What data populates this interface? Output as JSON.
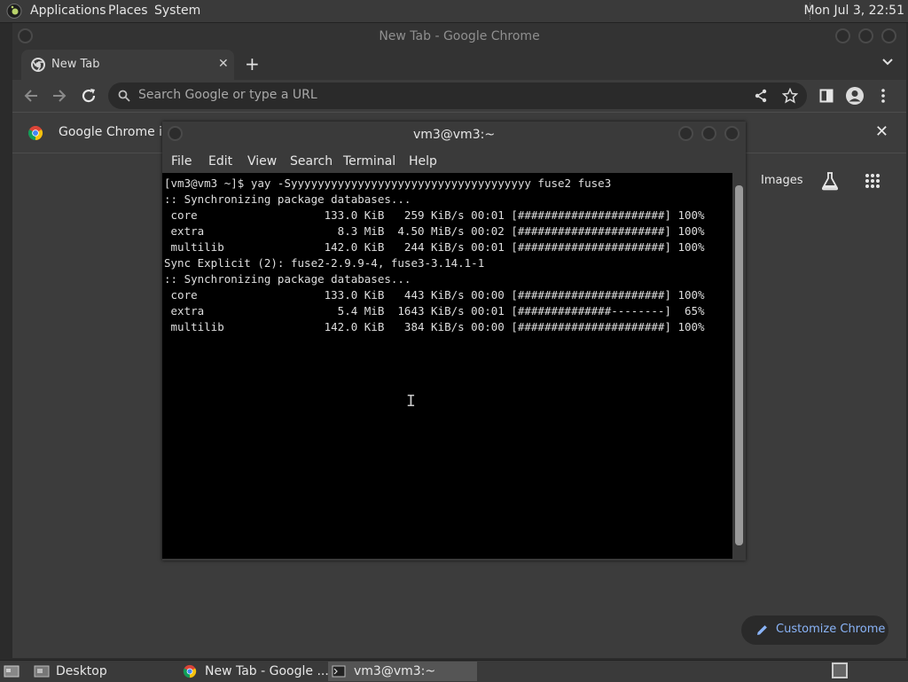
{
  "top_panel": {
    "menus": [
      "Applications",
      "Places",
      "System"
    ],
    "clock": "Mon Jul  3, 22:51"
  },
  "chrome": {
    "window_title": "New Tab - Google Chrome",
    "tab_title": "New Tab",
    "omnibox_placeholder": "Search Google or type a URL",
    "infobar_text": "Google Chrome isn",
    "images_link": "Images",
    "customize_label": "Customize Chrome"
  },
  "terminal": {
    "title": "vm3@vm3:~",
    "menus": [
      "File",
      "Edit",
      "View",
      "Search",
      "Terminal",
      "Help"
    ],
    "lines": [
      "[vm3@vm3 ~]$ yay -Syyyyyyyyyyyyyyyyyyyyyyyyyyyyyyyyyyyy fuse2 fuse3",
      ":: Synchronizing package databases...",
      " core                   133.0 KiB   259 KiB/s 00:01 [######################] 100%",
      " extra                    8.3 MiB  4.50 MiB/s 00:02 [######################] 100%",
      " multilib               142.0 KiB   244 KiB/s 00:01 [######################] 100%",
      "Sync Explicit (2): fuse2-2.9.9-4, fuse3-3.14.1-1",
      ":: Synchronizing package databases...",
      " core                   133.0 KiB   443 KiB/s 00:00 [######################] 100%",
      " extra                    5.4 MiB  1643 KiB/s 00:01 [##############--------]  65%",
      " multilib               142.0 KiB   384 KiB/s 00:00 [######################] 100%"
    ]
  },
  "taskbar": {
    "tasks": [
      "Desktop",
      "New Tab - Google ...",
      "vm3@vm3:~"
    ]
  }
}
